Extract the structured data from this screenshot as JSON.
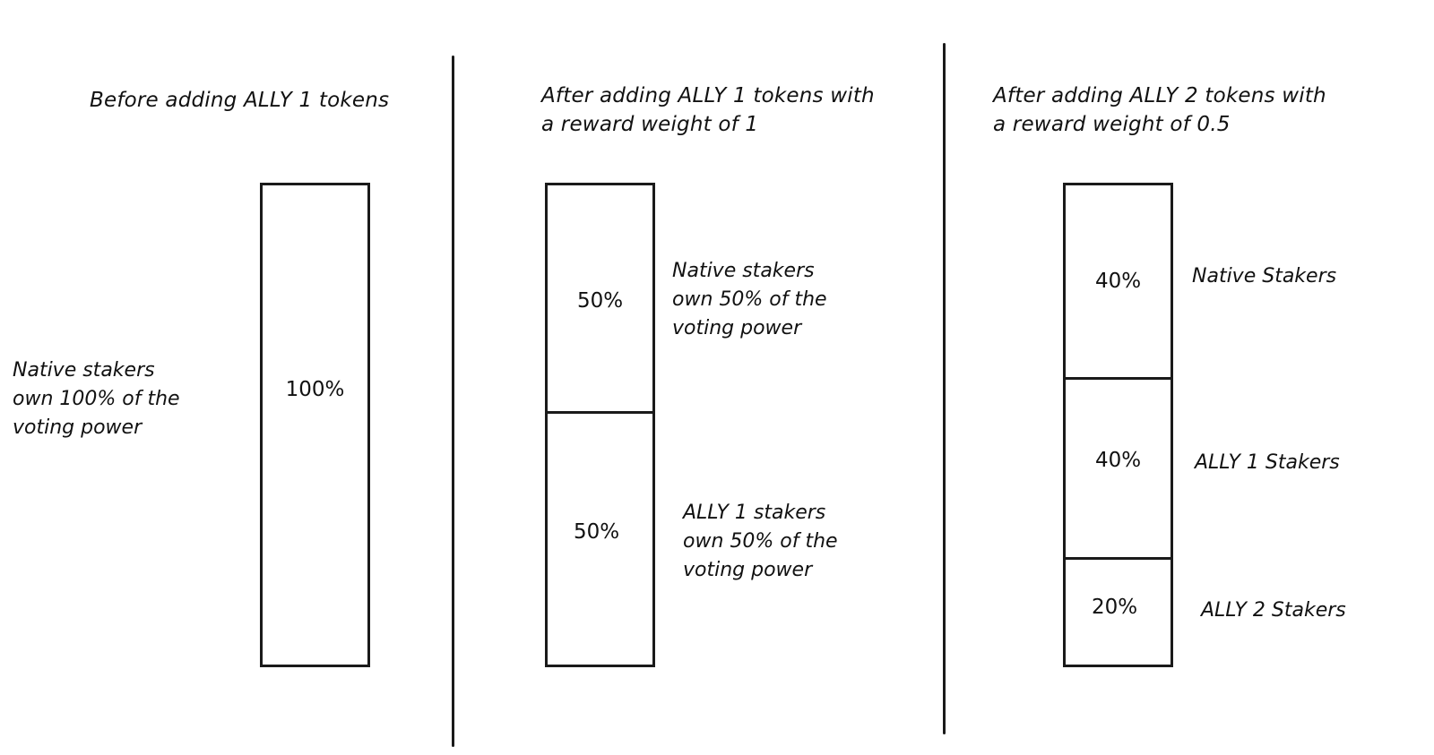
{
  "columns": [
    {
      "heading": [
        "Before adding ALLY 1 tokens"
      ],
      "segments": [
        {
          "percent": "100%",
          "label": [
            "Native stakers",
            "own 100% of the",
            "voting power"
          ]
        }
      ]
    },
    {
      "heading": [
        "After adding ALLY 1 tokens with",
        "a reward weight of 1"
      ],
      "segments": [
        {
          "percent": "50%",
          "label": [
            "Native stakers",
            "own 50% of the",
            "voting power"
          ]
        },
        {
          "percent": "50%",
          "label": [
            "ALLY 1 stakers",
            "own 50% of the",
            "voting power"
          ]
        }
      ]
    },
    {
      "heading": [
        "After adding ALLY 2 tokens with",
        "a reward weight of 0.5"
      ],
      "segments": [
        {
          "percent": "40%",
          "label": [
            "Native Stakers"
          ]
        },
        {
          "percent": "40%",
          "label": [
            "ALLY 1 Stakers"
          ]
        },
        {
          "percent": "20%",
          "label": [
            "ALLY 2 Stakers"
          ]
        }
      ]
    }
  ],
  "colors": {
    "ink": "#1a1a1a",
    "background": "#ffffff"
  }
}
